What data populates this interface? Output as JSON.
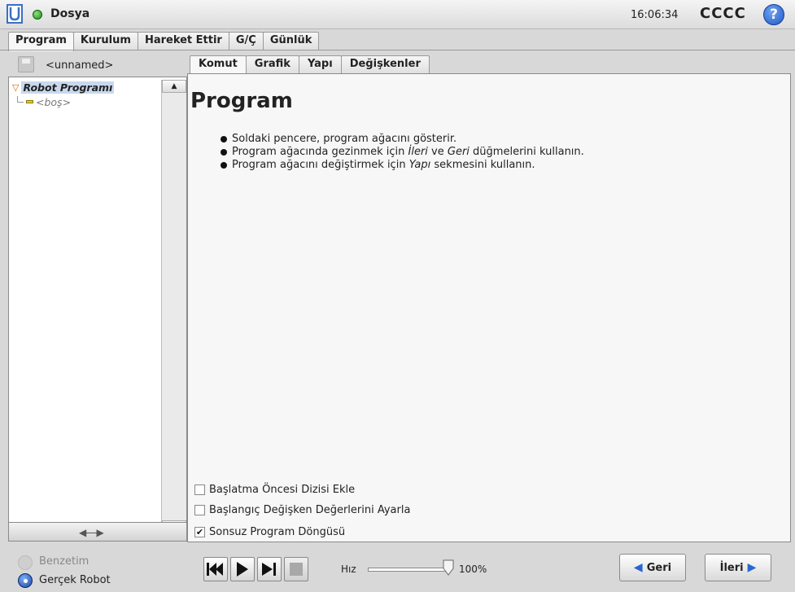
{
  "titlebar": {
    "file_menu": "Dosya",
    "clock": "16:06:34",
    "robot_name": "CCCC",
    "help_glyph": "?",
    "status_color": "#2a9a2a"
  },
  "main_tabs": [
    {
      "label": "Program",
      "active": true
    },
    {
      "label": "Kurulum",
      "active": false
    },
    {
      "label": "Hareket Ettir",
      "active": false
    },
    {
      "label": "G/Ç",
      "active": false
    },
    {
      "label": "Günlük",
      "active": false
    }
  ],
  "left_panel": {
    "filename": "<unnamed>",
    "tree": {
      "root_label": "Robot Programı",
      "child_label": "<boş>"
    },
    "icons": {
      "save": "save-icon",
      "nav": "left-right-arrows-icon"
    }
  },
  "sub_tabs": [
    {
      "label": "Komut",
      "active": true
    },
    {
      "label": "Grafik",
      "active": false
    },
    {
      "label": "Yapı",
      "active": false
    },
    {
      "label": "Değişkenler",
      "active": false
    }
  ],
  "content": {
    "heading": "Program",
    "help_items": [
      {
        "pre": "Soldaki pencere, program ağacını gösterir.",
        "em": "",
        "mid": "",
        "em2": "",
        "post": ""
      },
      {
        "pre": "Program ağacında gezinmek için ",
        "em": "İleri",
        "mid": " ve ",
        "em2": "Geri",
        "post": " düğmelerini kullanın."
      },
      {
        "pre": "Program ağacını değiştirmek için ",
        "em": "Yapı",
        "mid": " sekmesini kullanın.",
        "em2": "",
        "post": ""
      }
    ],
    "options": [
      {
        "label": "Başlatma Öncesi Dizisi Ekle",
        "checked": false
      },
      {
        "label": "Başlangıç Değişken Değerlerini Ayarla",
        "checked": false
      },
      {
        "label": "Sonsuz Program Döngüsü",
        "checked": true
      }
    ]
  },
  "bottom": {
    "simulation_label": "Benzetim",
    "real_robot_label": "Gerçek Robot",
    "mode_selected": "Gerçek Robot",
    "speed_label": "Hız",
    "speed_value": "100%",
    "speed_fraction": 1.0,
    "back_label": "Geri",
    "next_label": "İleri",
    "accent_color": "#2a66d0"
  }
}
